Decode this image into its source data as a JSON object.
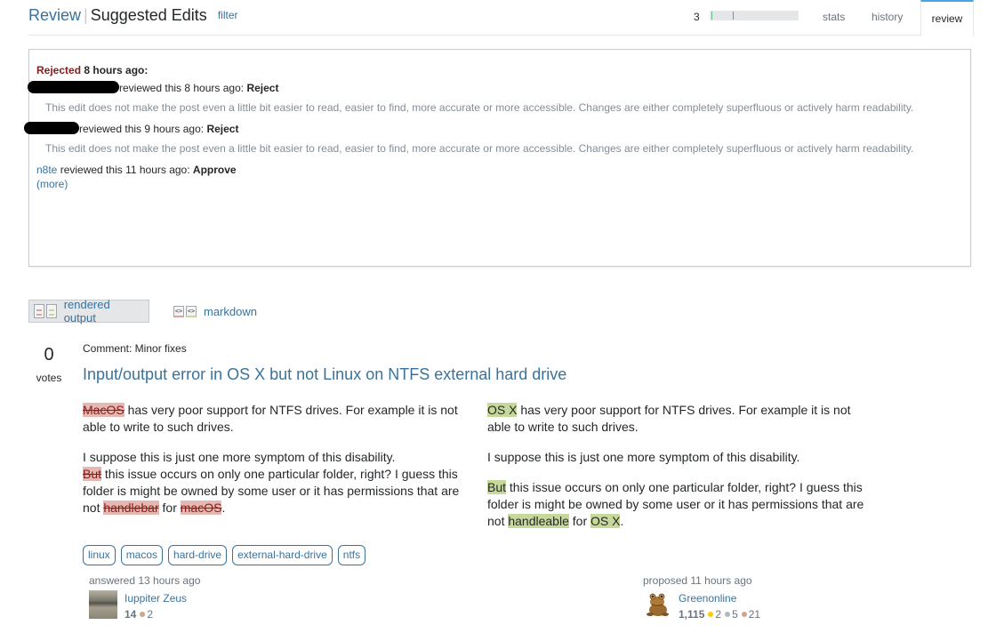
{
  "header": {
    "breadcrumb_root": "Review",
    "separator": "|",
    "queue_title": "Suggested Edits",
    "filter_label": "filter",
    "progress_count": "3",
    "tabs": [
      {
        "label": "stats",
        "active": false
      },
      {
        "label": "history",
        "active": false
      },
      {
        "label": "review",
        "active": true
      }
    ]
  },
  "review_summary": {
    "status": "Rejected",
    "status_time": "8 hours ago:",
    "entries": [
      {
        "reviewer": "[redacted]",
        "text": "reviewed this 8 hours ago:",
        "decision": "Reject",
        "reason": "This edit does not make the post even a little bit easier to read, easier to find, more accurate or more accessible. Changes are either completely superfluous or actively harm readability."
      },
      {
        "reviewer": "[redacted]",
        "text": "reviewed this 9 hours ago:",
        "decision": "Reject",
        "reason": "This edit does not make the post even a little bit easier to read, easier to find, more accurate or more accessible. Changes are either completely superfluous or actively harm readability."
      },
      {
        "reviewer": "n8te",
        "text": "reviewed this 11 hours ago:",
        "decision": "Approve",
        "reason": ""
      }
    ],
    "more_label": "(more)"
  },
  "view_toggles": {
    "rendered_label": "rendered output",
    "markdown_label": "markdown",
    "code_glyph": "<>"
  },
  "post": {
    "votes": "0",
    "votes_label": "votes",
    "comment": "Comment: Minor fixes",
    "title": "Input/output error in OS X but not Linux on NTFS external hard drive",
    "original": {
      "p1_del": "MacOS",
      "p1_rest": " has very poor support for NTFS drives. For example it is not able to write to such drives.",
      "p2_line1": "I suppose this is just one more symptom of this disability.",
      "p2_del1": "But",
      "p2_mid": " this issue occurs on only one particular folder, right? I guess this folder is might be owned by some user or it has permissions that are not ",
      "p2_del2": "handlebar",
      "p2_for": " for ",
      "p2_del3": "macOS",
      "p2_end": "."
    },
    "edited": {
      "p1_ins": "OS X",
      "p1_rest": " has very poor support for NTFS drives. For example it is not able to write to such drives.",
      "p2": "I suppose this is just one more symptom of this disability.",
      "p3_ins1": "But",
      "p3_mid": " this issue occurs on only one particular folder, right? I guess this folder is might be owned by some user or it has permissions that are not ",
      "p3_ins2": "handleable",
      "p3_for": " for ",
      "p3_ins3": "OS X",
      "p3_end": "."
    },
    "tags": [
      "linux",
      "macos",
      "hard-drive",
      "external-hard-drive",
      "ntfs"
    ]
  },
  "answered_card": {
    "action": "answered 13 hours ago",
    "name": "Iuppiter Zeus",
    "reputation": "14",
    "bronze": "2"
  },
  "proposed_card": {
    "action": "proposed 11 hours ago",
    "name": "Greenonline",
    "reputation": "1,115",
    "gold": "2",
    "silver": "5",
    "bronze": "21"
  },
  "colors": {
    "link": "#39739d",
    "rejected": "#8b1a1a",
    "deleted_bg": "#e6b8b2",
    "inserted_bg": "#c6d99a",
    "active_tab_accent": "#48a5e5"
  }
}
